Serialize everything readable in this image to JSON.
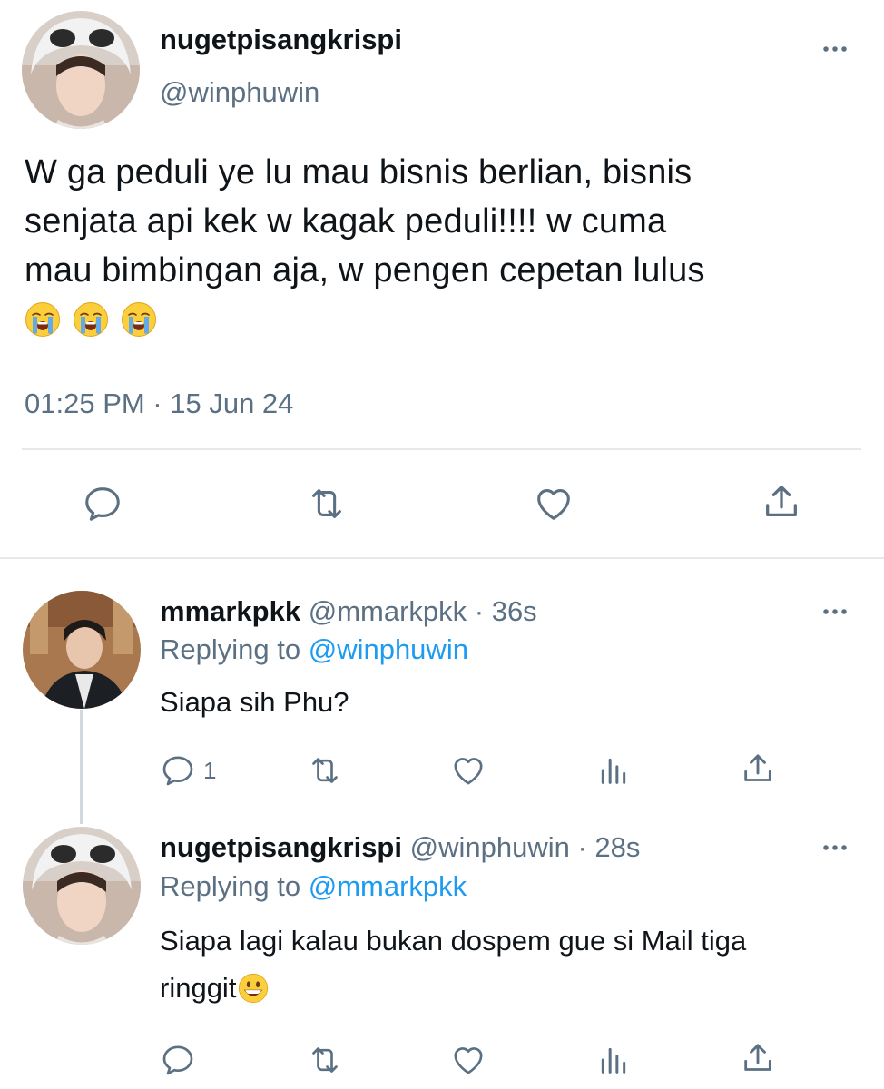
{
  "main_tweet": {
    "display_name": "nugetpisangkrispi",
    "handle": "@winphuwin",
    "text_lines": [
      "W ga peduli ye lu mau bisnis berlian, bisnis",
      "senjata api kek w kagak peduli!!!! w cuma",
      "mau bimbingan aja, w pengen cepetan lulus"
    ],
    "emojis": [
      "loudly-crying-face",
      "loudly-crying-face",
      "loudly-crying-face"
    ],
    "timestamp": "01:25 PM · 15 Jun 24",
    "actions": [
      "reply-icon",
      "retweet-icon",
      "like-icon",
      "share-icon"
    ]
  },
  "replies": [
    {
      "display_name": "mmarkpkk",
      "handle": "@mmarkpkk",
      "time": "· 36s",
      "replying_label": "Replying to",
      "replying_to": "@winphuwin",
      "text": "Siapa sih Phu?",
      "reply_count": "1",
      "actions": [
        "reply-icon",
        "retweet-icon",
        "like-icon",
        "analytics-icon",
        "share-icon"
      ]
    },
    {
      "display_name": "nugetpisangkrispi",
      "handle": "@winphuwin",
      "time": "· 28s",
      "replying_label": "Replying to",
      "replying_to": "@mmarkpkk",
      "text_lines": [
        "Siapa lagi kalau bukan dospem gue si Mail tiga",
        "ringgit"
      ],
      "emoji": "grinning-face",
      "reply_count": "",
      "actions": [
        "reply-icon",
        "retweet-icon",
        "like-icon",
        "analytics-icon",
        "share-icon"
      ]
    }
  ],
  "colors": {
    "text": "#0f1419",
    "secondary": "#5b7083",
    "link": "#1d9bf0",
    "divider": "#e6e9ec"
  }
}
